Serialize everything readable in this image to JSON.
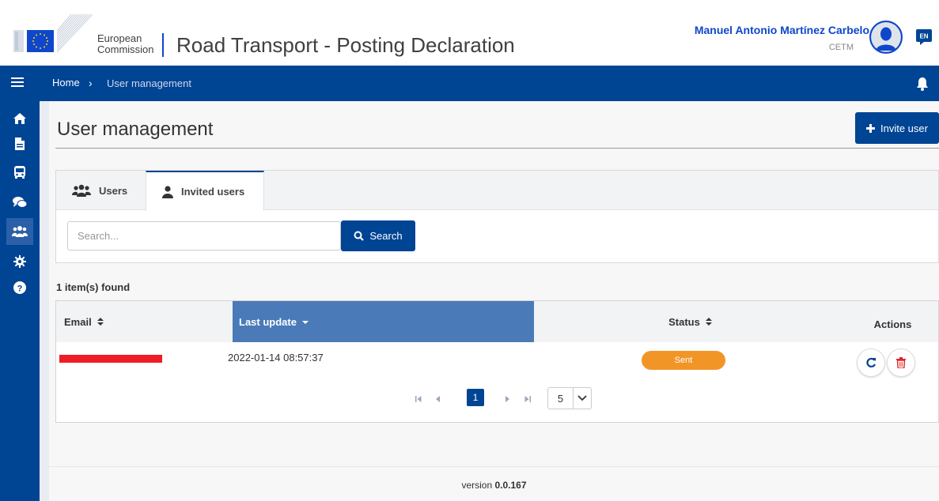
{
  "header": {
    "logo_line1": "European",
    "logo_line2": "Commission",
    "app_title": "Road Transport - Posting Declaration",
    "user_name": "Manuel Antonio Martínez Carbelo",
    "user_org": "CETM",
    "language": "EN"
  },
  "breadcrumb": {
    "home": "Home",
    "separator": "›",
    "current": "User management"
  },
  "sidebar": {
    "items": [
      {
        "icon": "home-icon"
      },
      {
        "icon": "document-icon"
      },
      {
        "icon": "bus-icon"
      },
      {
        "icon": "chat-icon"
      },
      {
        "icon": "users-icon",
        "active": true
      },
      {
        "icon": "gear-icon"
      },
      {
        "icon": "help-icon"
      }
    ]
  },
  "page": {
    "title": "User management",
    "invite_label": "Invite user"
  },
  "tabs": [
    {
      "label": "Users",
      "icon": "users-icon",
      "active": false
    },
    {
      "label": "Invited users",
      "icon": "user-icon",
      "active": true
    }
  ],
  "search": {
    "placeholder": "Search...",
    "value": "",
    "button_label": "Search"
  },
  "results": {
    "count_text": "1 item(s) found"
  },
  "table": {
    "columns": [
      {
        "label": "Email",
        "sort": "both"
      },
      {
        "label": "Last update",
        "sort": "desc"
      },
      {
        "label": "Status",
        "sort": "both"
      },
      {
        "label": "Actions"
      }
    ],
    "rows": [
      {
        "email": "",
        "last_update": "2022-01-14 08:57:37",
        "status": "Sent"
      }
    ]
  },
  "pagination": {
    "current_page": "1",
    "page_size": "5"
  },
  "footer": {
    "version_label": "version",
    "version_value": "0.0.167"
  },
  "colors": {
    "primary": "#004494",
    "accent_blue": "#0e47cb",
    "sorted_header": "#4a7ab8",
    "status_sent": "#f29527",
    "danger": "#e02424"
  }
}
